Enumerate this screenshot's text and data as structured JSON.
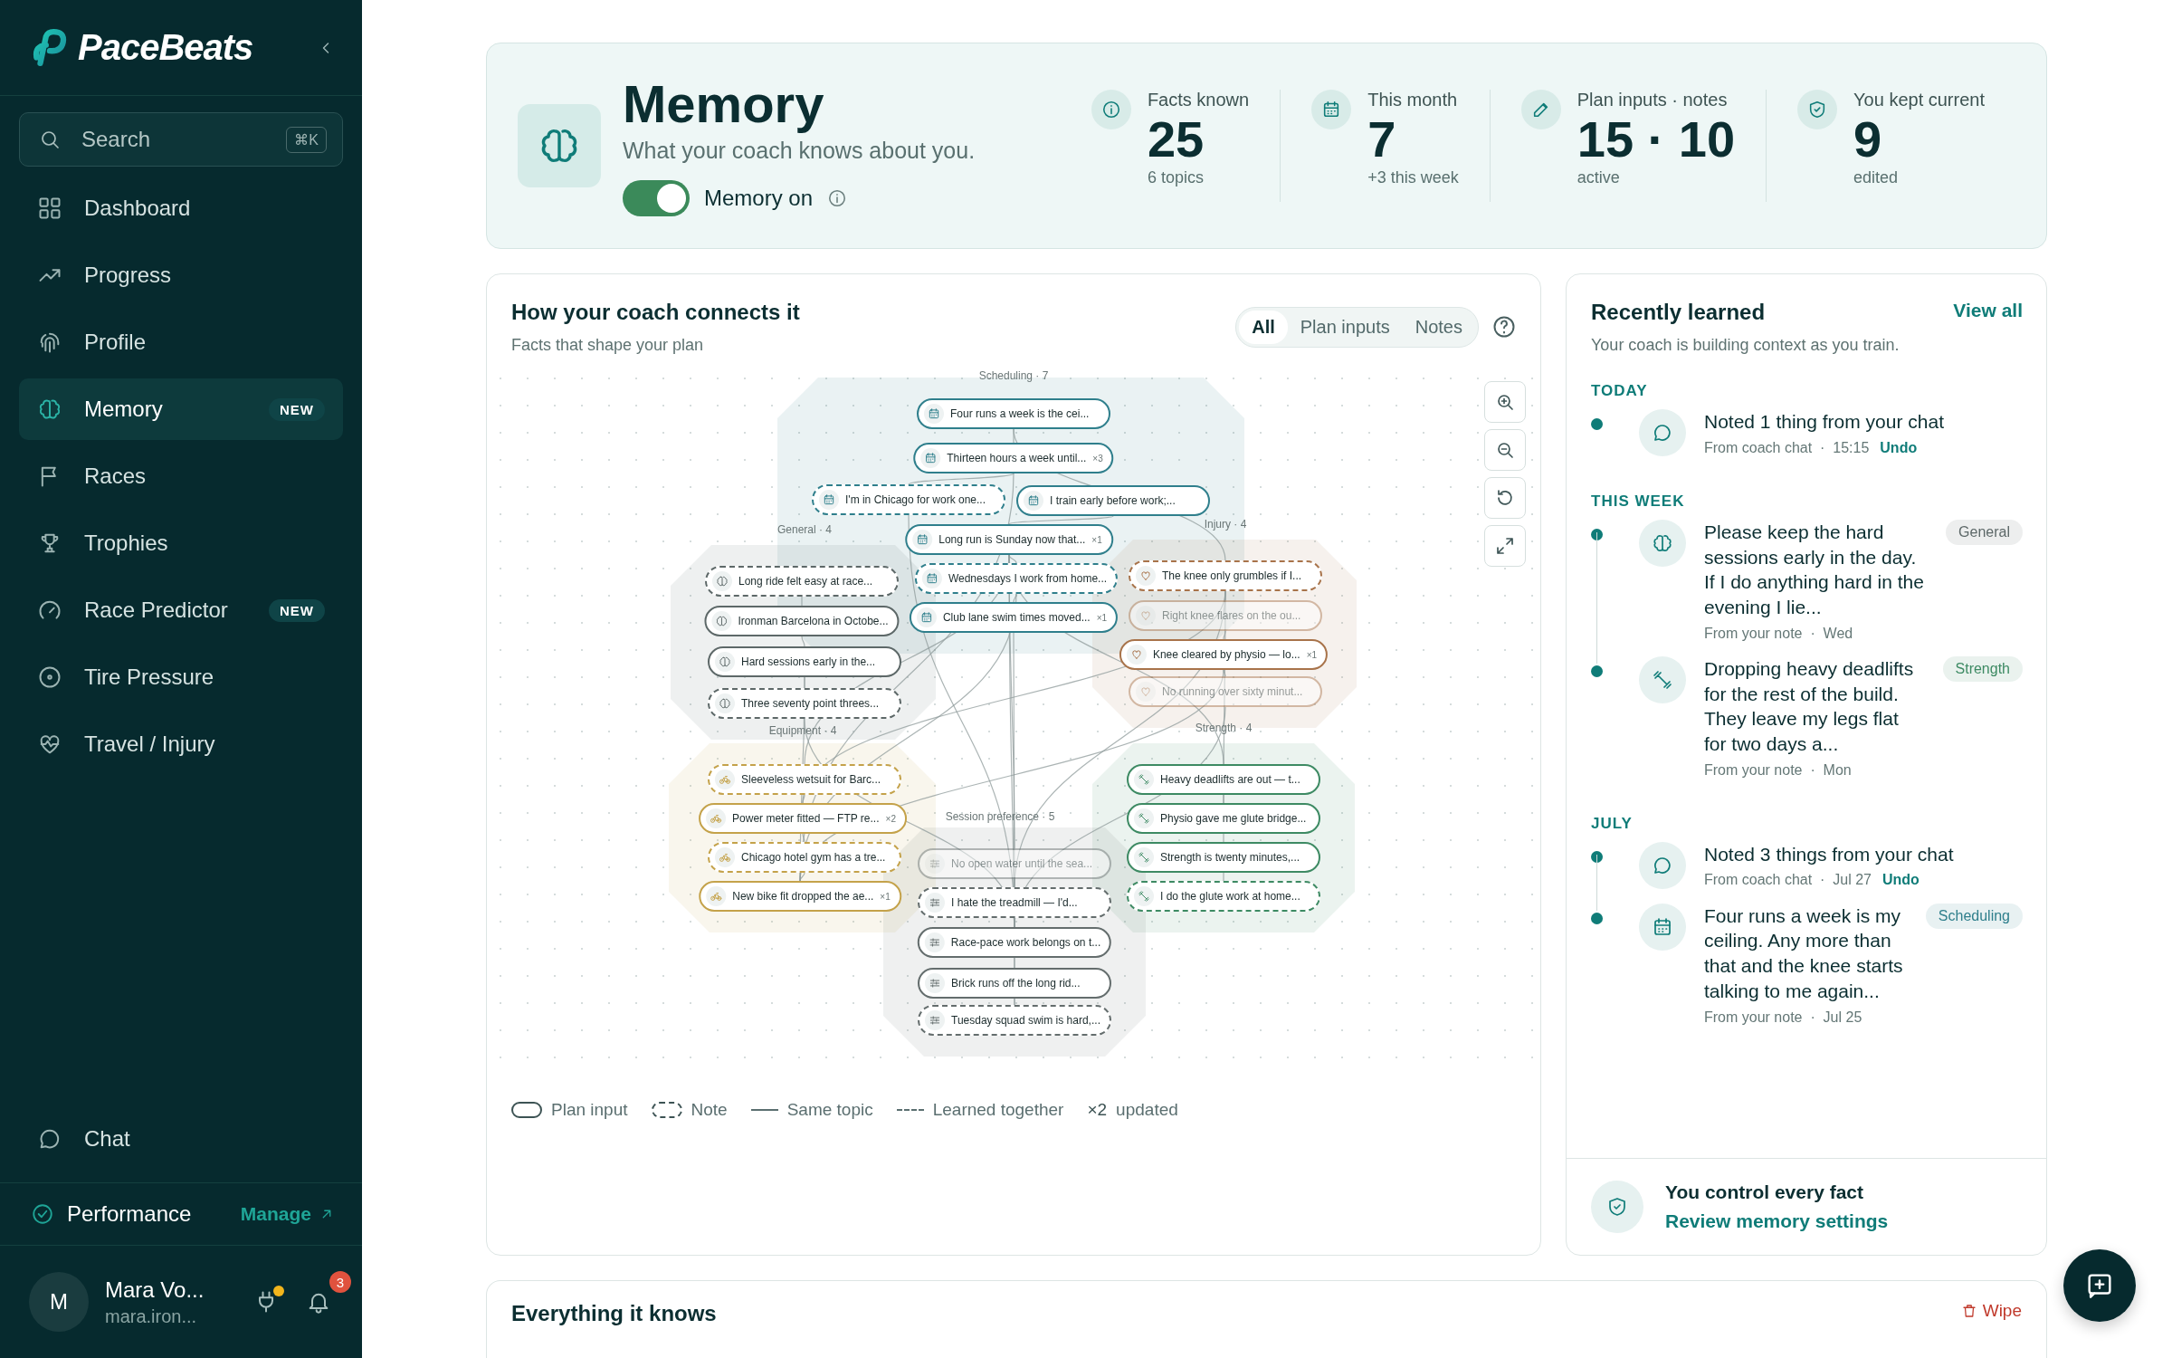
{
  "sidebar": {
    "brand": "PaceBeats",
    "search": {
      "placeholder": "Search",
      "shortcut": "⌘K"
    },
    "items": [
      {
        "label": "Dashboard",
        "selected": false
      },
      {
        "label": "Progress",
        "selected": false
      },
      {
        "label": "Profile",
        "selected": false
      },
      {
        "label": "Memory",
        "selected": true,
        "badge": "NEW"
      },
      {
        "label": "Races",
        "selected": false
      },
      {
        "label": "Trophies",
        "selected": false
      },
      {
        "label": "Race Predictor",
        "selected": false,
        "badge": "NEW"
      },
      {
        "label": "Tire Pressure",
        "selected": false
      },
      {
        "label": "Travel / Injury",
        "selected": false
      }
    ],
    "chat": "Chat",
    "workspace": {
      "label": "Performance",
      "action": "Manage"
    },
    "user": {
      "initial": "M",
      "name": "Mara Vo...",
      "email": "mara.iron...",
      "notifications": "3"
    }
  },
  "header": {
    "title": "Memory",
    "subtitle": "What your coach knows about you.",
    "toggle": {
      "label": "Memory on",
      "on": true
    },
    "stats": [
      {
        "label": "Facts known",
        "value": "25",
        "note": "6 topics"
      },
      {
        "label": "This month",
        "value": "7",
        "note": "+3 this week"
      },
      {
        "label": "Plan inputs · notes",
        "value": "15 · 10",
        "note": "active"
      },
      {
        "label": "You kept current",
        "value": "9",
        "note": "edited"
      }
    ]
  },
  "graph": {
    "title": "How your coach connects it",
    "subtitle": "Facts that shape your plan",
    "filters": [
      {
        "label": "All",
        "selected": true
      },
      {
        "label": "Plan inputs",
        "selected": false
      },
      {
        "label": "Notes",
        "selected": false
      }
    ],
    "topics": [
      {
        "label": "Scheduling · 7",
        "color": "#2f7f8c",
        "nodes": [
          {
            "text": "Four runs a week is the cei...",
            "kind": "plan_input",
            "dimmed": false
          },
          {
            "text": "Thirteen hours a week until...",
            "kind": "plan_input",
            "count": "×3",
            "dimmed": false
          },
          {
            "text": "I'm in Chicago for work one...",
            "kind": "note",
            "dimmed": false
          },
          {
            "text": "I train early before work;...",
            "kind": "plan_input",
            "dimmed": false
          },
          {
            "text": "Long run is Sunday now that...",
            "kind": "plan_input",
            "count": "×1",
            "dimmed": false
          },
          {
            "text": "Wednesdays I work from home...",
            "kind": "note",
            "dimmed": false
          },
          {
            "text": "Club lane swim times moved...",
            "kind": "plan_input",
            "count": "×1",
            "dimmed": false
          }
        ]
      },
      {
        "label": "General · 4",
        "color": "#5d6868",
        "nodes": [
          {
            "text": "Long ride felt easy at race...",
            "kind": "note",
            "dimmed": false
          },
          {
            "text": "Ironman Barcelona in Octobe...",
            "kind": "plan_input",
            "dimmed": false
          },
          {
            "text": "Hard sessions early in the...",
            "kind": "plan_input",
            "dimmed": false
          },
          {
            "text": "Three seventy point threes...",
            "kind": "note",
            "dimmed": false
          }
        ]
      },
      {
        "label": "Injury · 4",
        "color": "#a8734a",
        "nodes": [
          {
            "text": "The knee only grumbles if I...",
            "kind": "note",
            "dimmed": false
          },
          {
            "text": "Right knee flares on the ou...",
            "kind": "plan_input",
            "dimmed": true
          },
          {
            "text": "Knee cleared by physio — lo...",
            "kind": "plan_input",
            "count": "×1",
            "dimmed": false
          },
          {
            "text": "No running over sixty minut...",
            "kind": "plan_input",
            "dimmed": true
          }
        ]
      },
      {
        "label": "Equipment · 4",
        "color": "#c4a24a",
        "nodes": [
          {
            "text": "Sleeveless wetsuit for Barc...",
            "kind": "note",
            "dimmed": false
          },
          {
            "text": "Power meter fitted — FTP re...",
            "kind": "plan_input",
            "count": "×2",
            "dimmed": false
          },
          {
            "text": "Chicago hotel gym has a tre...",
            "kind": "note",
            "dimmed": false
          },
          {
            "text": "New bike fit dropped the ae...",
            "kind": "plan_input",
            "count": "×1",
            "dimmed": false
          }
        ]
      },
      {
        "label": "Strength · 4",
        "color": "#3d8a63",
        "nodes": [
          {
            "text": "Heavy deadlifts are out — t...",
            "kind": "plan_input",
            "dimmed": false
          },
          {
            "text": "Physio gave me glute bridge...",
            "kind": "plan_input",
            "dimmed": false
          },
          {
            "text": "Strength is twenty minutes,...",
            "kind": "plan_input",
            "dimmed": false
          },
          {
            "text": "I do the glute work at home...",
            "kind": "note",
            "dimmed": false
          }
        ]
      },
      {
        "label": "Session preference · 5",
        "color": "#646d6d",
        "nodes": [
          {
            "text": "No open water until the sea...",
            "kind": "plan_input",
            "dimmed": true
          },
          {
            "text": "I hate the treadmill — I'd...",
            "kind": "note",
            "dimmed": false
          },
          {
            "text": "Race-pace work belongs on t...",
            "kind": "plan_input",
            "dimmed": false
          },
          {
            "text": "Brick runs off the long rid...",
            "kind": "plan_input",
            "dimmed": false
          },
          {
            "text": "Tuesday squad swim is hard,...",
            "kind": "note",
            "dimmed": false
          }
        ]
      }
    ],
    "legend": [
      {
        "kind": "plan_input",
        "label": "Plan input"
      },
      {
        "kind": "note",
        "label": "Note"
      },
      {
        "kind": "same_topic",
        "label": "Same topic"
      },
      {
        "kind": "learned_together",
        "label": "Learned together"
      },
      {
        "kind": "updated",
        "symbol": "×2",
        "label": "updated"
      }
    ]
  },
  "recent": {
    "title": "Recently learned",
    "subtitle": "Your coach is building context as you train.",
    "action": "View all",
    "groups": [
      {
        "label": "TODAY",
        "items": [
          {
            "kind": "chat",
            "text": "Noted 1 thing from your chat",
            "meta": "From coach chat  ·  15:15",
            "undo": "Undo"
          }
        ]
      },
      {
        "label": "THIS WEEK",
        "items": [
          {
            "kind": "general",
            "text": "Please keep the hard sessions early in the day. If I do anything hard in the evening I lie...",
            "meta": "From your note  ·  Wed",
            "tag": {
              "label": "General",
              "color": "#5d6868"
            }
          },
          {
            "kind": "strength",
            "text": "Dropping heavy deadlifts for the rest of the build. They leave my legs flat for two days a...",
            "meta": "From your note  ·  Mon",
            "tag": {
              "label": "Strength",
              "color": "#3d8a63"
            }
          }
        ]
      },
      {
        "label": "JULY",
        "items": [
          {
            "kind": "chat",
            "text": "Noted 3 things from your chat",
            "meta": "From coach chat  ·  Jul 27",
            "undo": "Undo"
          },
          {
            "kind": "scheduling",
            "text": "Four runs a week is my ceiling. Any more than that and the knee starts talking to me again...",
            "meta": "From your note  ·  Jul 25",
            "tag": {
              "label": "Scheduling",
              "color": "#2f7f8c"
            }
          }
        ]
      }
    ],
    "footer": {
      "title": "You control every fact",
      "link": "Review memory settings"
    }
  },
  "everything": {
    "title": "Everything it knows",
    "action": "Wipe"
  }
}
